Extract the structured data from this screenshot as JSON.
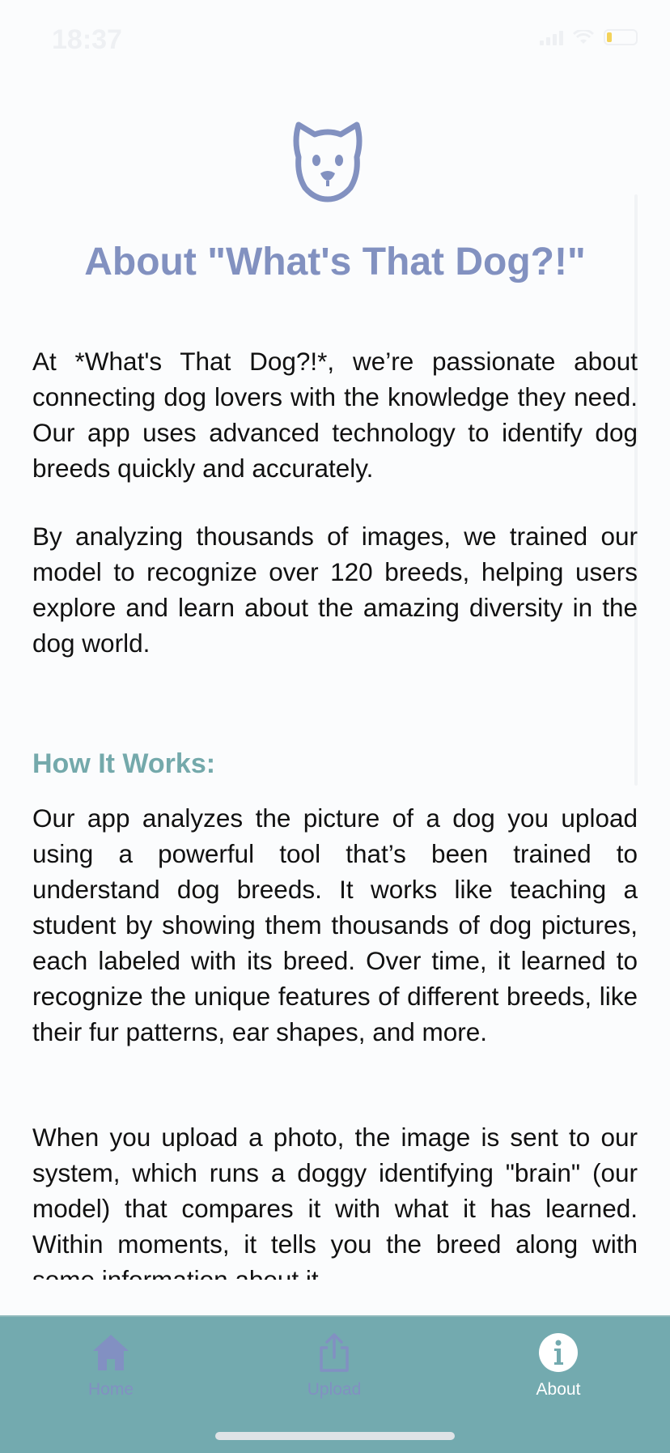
{
  "status_bar": {
    "time": "18:37",
    "battery_color": "#f3d25a"
  },
  "about": {
    "logo_icon": "dog-face-icon",
    "title": "About \"What's That Dog?!\"",
    "paragraphs": [
      "At *What's That Dog?!*, we’re passionate about connecting dog lovers with the knowledge they need. Our app uses advanced technology to identify dog breeds quickly and accurately.",
      "By analyzing thousands of images, we trained our model to recognize over 120 breeds, helping users explore and learn about the amazing diversity in the dog world."
    ],
    "how_it_works": {
      "heading": "How It Works:",
      "paragraphs": [
        "Our app analyzes the picture of a dog you upload using a powerful tool that’s been trained to understand dog breeds. It works like teaching a student by showing them thousands of dog pictures, each labeled with its breed. Over time, it learned to recognize the unique features of different breeds, like their fur patterns, ear shapes, and more.",
        "When you upload a photo, the image is sent to our system, which runs a doggy identifying \"brain\" (our model) that compares it with what it has learned. Within moments, it tells you the breed along with some information about it."
      ]
    }
  },
  "tab_bar": {
    "tabs": [
      {
        "label": "Home",
        "icon": "home-icon",
        "active": false
      },
      {
        "label": "Upload",
        "icon": "upload-icon",
        "active": false
      },
      {
        "label": "About",
        "icon": "info-icon",
        "active": true
      }
    ],
    "background": "#73aaaf",
    "inactive_color": "#8290c2",
    "active_color": "#ffffff"
  },
  "colors": {
    "title": "#8291c0",
    "section_heading": "#74a9ab",
    "body_text": "#111111"
  }
}
